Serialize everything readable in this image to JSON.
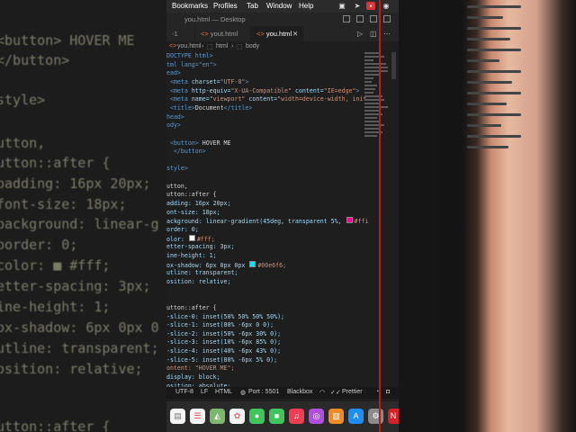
{
  "menubar": {
    "items": [
      "Bookmarks",
      "Profiles",
      "Tab",
      "Window",
      "Help"
    ]
  },
  "window": {
    "title": "you.html — Desktop"
  },
  "tabs": [
    {
      "label": "-1"
    },
    {
      "label": "yout.html"
    },
    {
      "label": "you.html"
    }
  ],
  "breadcrumb": {
    "file": "you.html",
    "node1": "html",
    "node2": "body"
  },
  "code": {
    "doctype": "DOCTYPE html>",
    "html_open": "tml lang=\"en\">",
    "head": "ead>",
    "charset_attr": "charset=",
    "charset_val": "\"UTF-8\"",
    "equiv_attr": "http-equiv=",
    "equiv_val": "\"X-UA-Compatible\"",
    "content_attr": "content=",
    "ie_val": "\"IE=edge\"",
    "name_attr": "name=",
    "viewport_val": "\"viewport\"",
    "vp_content": "\"width=device-width, init",
    "title_text": "Document",
    "head_close": "head>",
    "body_open": "ody>",
    "button_text": "HOVER ME",
    "style_open": "style>",
    "sel1": "utton,",
    "sel2": "utton::after {",
    "padding": "adding: 16px 20px;",
    "fontsize": "ont-size: 18px;",
    "bg_prop": "ackground: linear-gradient(45deg, transparent 5%, ",
    "bg_val": "#ffi",
    "border": "order: 0;",
    "color_prop": "olor: ",
    "color_val": "#fff;",
    "ls": "etter-spacing: 3px;",
    "lh": "ine-height: 1;",
    "shadow_prop": "ox-shadow: 6px 0px 0px ",
    "shadow_val": "#00e6f6;",
    "outline": "utline: transparent;",
    "position": "osition: relative;",
    "sel3": "utton::after {",
    "s0": "-slice-0: inset(50% 50% 50% 50%);",
    "s1": "-slice-1: inset(80% -6px 0 0);",
    "s2": "-slice-2: inset(50% -6px 30% 0);",
    "s3": "-slice-3: inset(10% -6px 85% 0);",
    "s4": "-slice-4: inset(40% -6px 43% 0);",
    "s5": "-slice-5: inset(80% -6px 5% 0);",
    "content_line": "ontent: \"HOVER ME\";",
    "display": "display: block;",
    "pos_abs": "osition: absolute;"
  },
  "statusbar": {
    "encoding": "UTF-8",
    "eol": "LF",
    "lang": "HTML",
    "port": "Port : 5501",
    "theme": "Blackbox",
    "prettier": "Prettier"
  },
  "background_left": {
    "lines": [
      "<button> HOVER ME",
      "</button>",
      "style>",
      "utton,",
      "utton::after {",
      "padding: 16px 20px;",
      "font-size: 18px;",
      "background: linear-g",
      "border: 0;",
      "color: ■ #fff;",
      "etter-spacing: 3px;",
      "ine-height: 1;",
      "ox-shadow: 6px 0px 0",
      "utline: transparent;",
      "osition: relative;",
      "utton::after {"
    ]
  },
  "colors": {
    "accent_blue": "#569cd6",
    "string": "#ce9178",
    "attr": "#9cdcfe",
    "swatch_pink": "#ff0090",
    "swatch_cyan": "#00e6f6",
    "red_line": "#c41818"
  }
}
